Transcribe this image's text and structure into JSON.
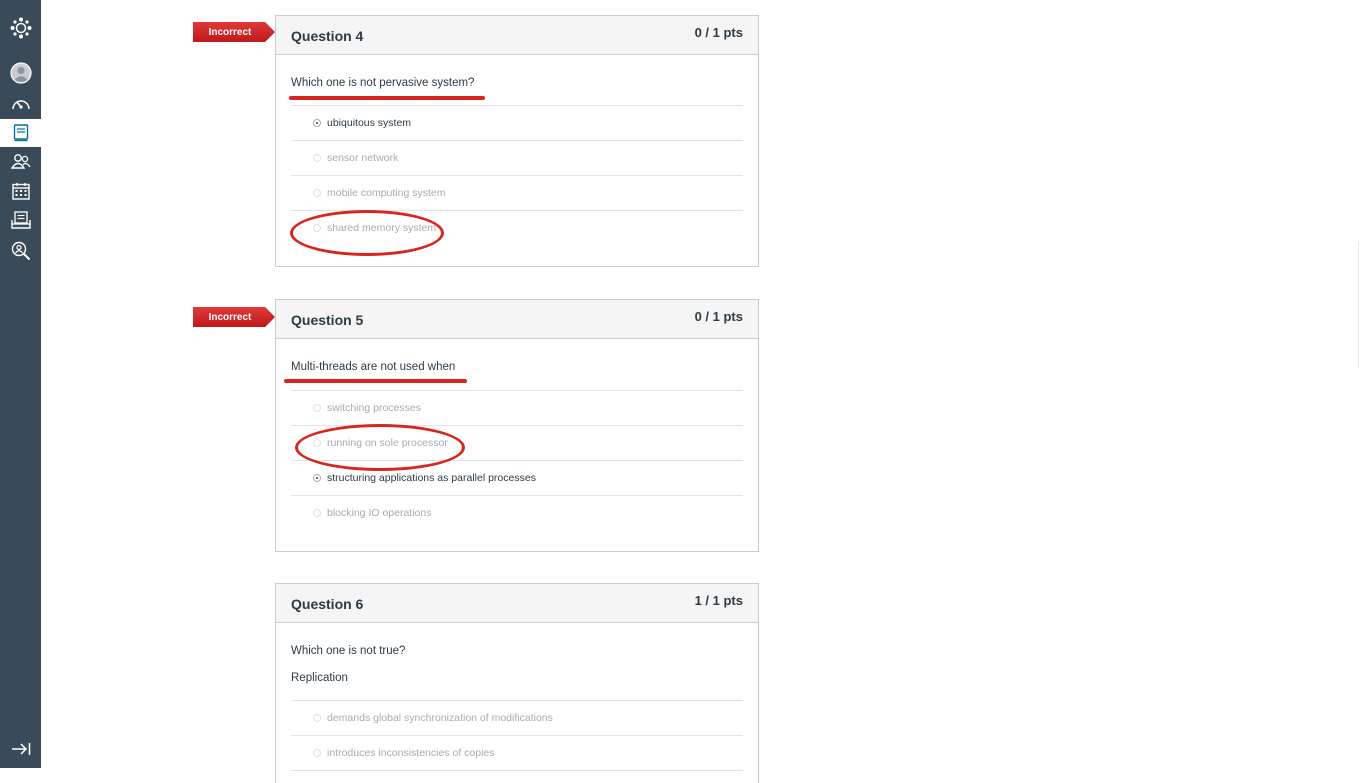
{
  "nav": {
    "items": [
      "logo",
      "account",
      "dashboard",
      "courses",
      "groups",
      "calendar",
      "inbox",
      "commons"
    ],
    "collapse_label": "collapse"
  },
  "questions": [
    {
      "status": "Incorrect",
      "title": "Question 4",
      "points": "0 / 1 pts",
      "text_lines": [
        "Which one is not pervasive system?"
      ],
      "answers": [
        {
          "label": "ubiquitous system",
          "selected": true
        },
        {
          "label": "sensor network",
          "selected": false
        },
        {
          "label": "mobile computing system",
          "selected": false
        },
        {
          "label": "shared memory system",
          "selected": false
        }
      ]
    },
    {
      "status": "Incorrect",
      "title": "Question 5",
      "points": "0 / 1 pts",
      "text_lines": [
        "Multi-threads are not used when"
      ],
      "answers": [
        {
          "label": "switching processes",
          "selected": false
        },
        {
          "label": "running on sole processor",
          "selected": false
        },
        {
          "label": "structuring applications as parallel processes",
          "selected": true
        },
        {
          "label": "blocking IO operations",
          "selected": false
        }
      ]
    },
    {
      "status": "",
      "title": "Question 6",
      "points": "1 / 1 pts",
      "text_lines": [
        "Which one is not true?",
        "Replication"
      ],
      "answers": [
        {
          "label": "demands global synchronization of modifications",
          "selected": false
        },
        {
          "label": "introduces inconsistencies of copies",
          "selected": false
        }
      ]
    }
  ],
  "colors": {
    "nav_bg": "#394b58",
    "incorrect_badge": "#d0282a",
    "annotation": "#d7261e",
    "text": "#2d3b45",
    "muted_text": "#a3acb3"
  }
}
